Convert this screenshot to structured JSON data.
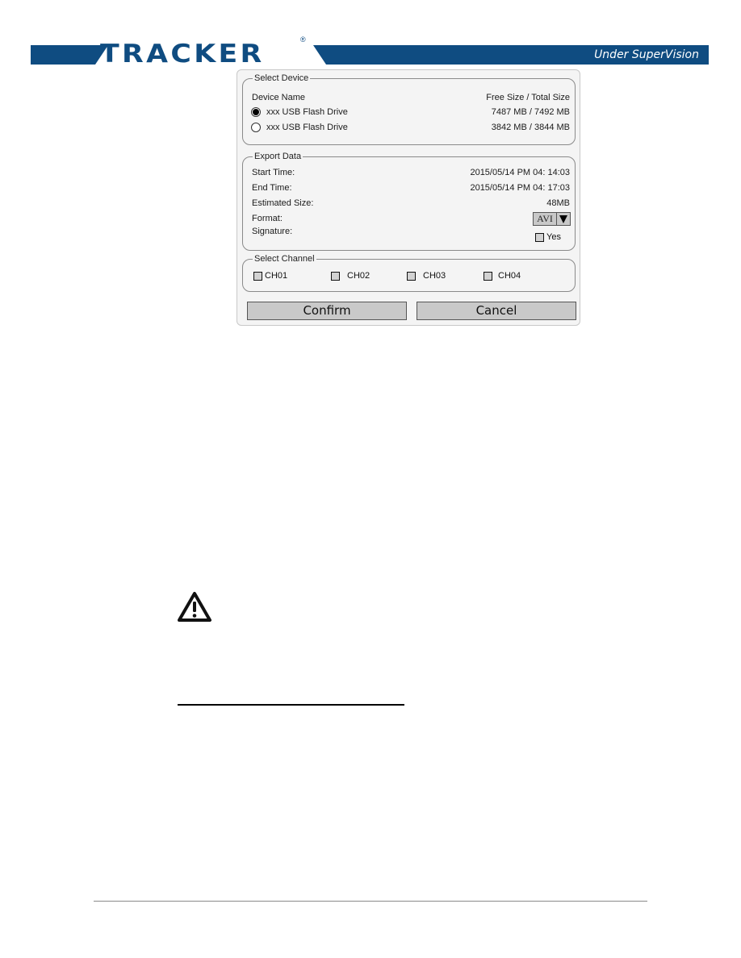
{
  "header": {
    "logo_text": "TRACKER",
    "registered_mark": "®",
    "tagline": "Under SuperVision",
    "brand_color": "#0f4c81"
  },
  "dialog": {
    "select_device": {
      "legend": "Select Device",
      "col_name": "Device Name",
      "col_size": "Free Size / Total Size",
      "devices": [
        {
          "name": "xxx USB Flash Drive",
          "size": "7487 MB / 7492 MB",
          "selected": true
        },
        {
          "name": "xxx USB Flash Drive",
          "size": "3842 MB / 3844 MB",
          "selected": false
        }
      ]
    },
    "export_data": {
      "legend": "Export Data",
      "start_label": "Start Time:",
      "start_value": "2015/05/14 PM 04: 14:03",
      "end_label": "End Time:",
      "end_value": "2015/05/14 PM 04: 17:03",
      "size_label": "Estimated Size:",
      "size_value": "48MB",
      "format_label": "Format:",
      "format_value": "AVI",
      "signature_label": "Signature:",
      "signature_option": "Yes",
      "signature_checked": false
    },
    "select_channel": {
      "legend": "Select Channel",
      "channels": [
        {
          "label": "CH01",
          "checked": false
        },
        {
          "label": "CH02",
          "checked": false
        },
        {
          "label": "CH03",
          "checked": false
        },
        {
          "label": "CH04",
          "checked": false
        }
      ]
    },
    "confirm_label": "Confirm",
    "cancel_label": "Cancel"
  },
  "icons": {
    "caution": "warning-triangle"
  }
}
